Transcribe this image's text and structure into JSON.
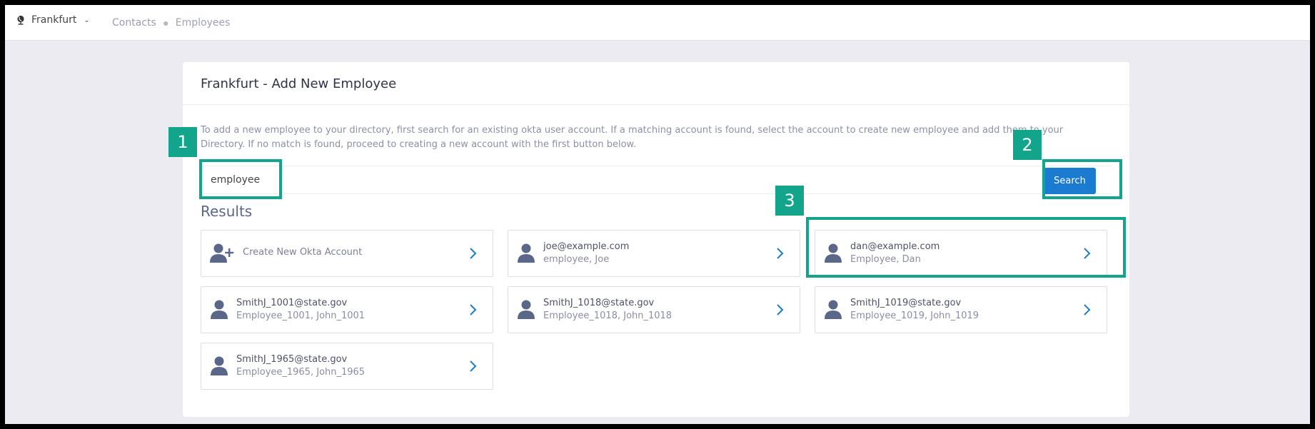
{
  "topbar": {
    "org_name": "Frankfurt",
    "breadcrumbs": [
      "Contacts",
      "Employees"
    ]
  },
  "card": {
    "title": "Frankfurt - Add New Employee",
    "intro": "To add a new employee to your directory, first search for an existing okta user account. If a matching account is found, select the account to create new employee and add them to your Directory. If no match is found, proceed to creating a new account with the first button below."
  },
  "search": {
    "value": "employee",
    "button_label": "Search"
  },
  "results": {
    "title": "Results",
    "create_label": "Create New Okta Account",
    "items": [
      {
        "email": "joe@example.com",
        "name": "employee, Joe"
      },
      {
        "email": "dan@example.com",
        "name": "Employee, Dan"
      },
      {
        "email": "SmithJ_1001@state.gov",
        "name": "Employee_1001, John_1001"
      },
      {
        "email": "SmithJ_1018@state.gov",
        "name": "Employee_1018, John_1018"
      },
      {
        "email": "SmithJ_1019@state.gov",
        "name": "Employee_1019, John_1019"
      },
      {
        "email": "SmithJ_1965@state.gov",
        "name": "Employee_1965, John_1965"
      }
    ]
  },
  "annotations": [
    "1",
    "2",
    "3"
  ],
  "colors": {
    "accent": "#1a7bd0",
    "callout": "#13a58b",
    "background": "#ecebf1"
  }
}
